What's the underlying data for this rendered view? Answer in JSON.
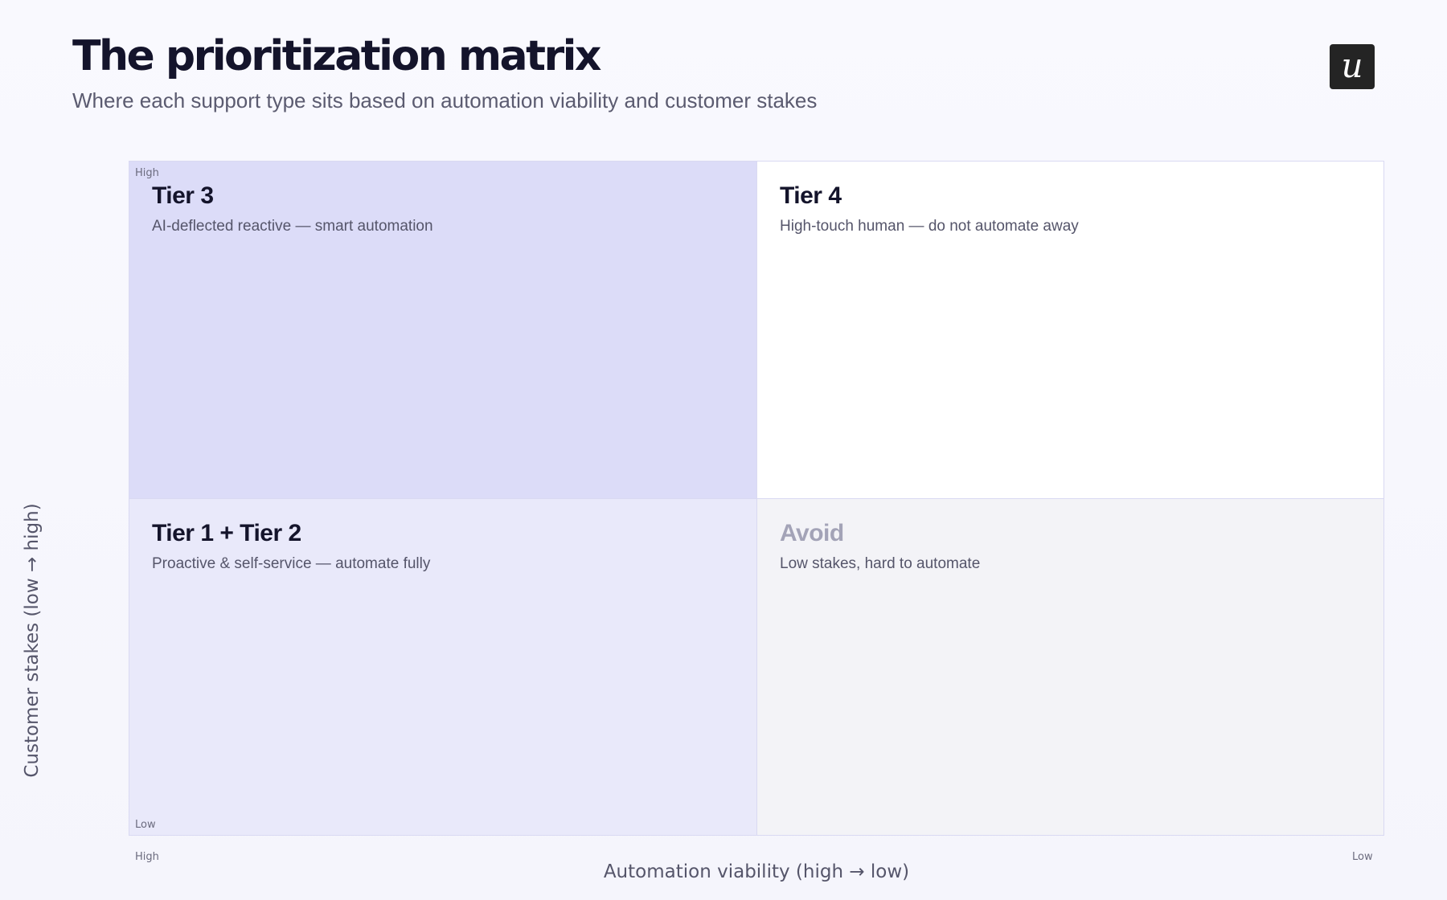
{
  "title": "The prioritization matrix",
  "subtitle": "Where each support type sits based on automation viability and customer stakes",
  "logo": {
    "glyph": "u",
    "icon": "userpilot-logo-icon"
  },
  "quadrants": {
    "top_left": {
      "title": "Tier 3",
      "description": "AI-deflected reactive — smart automation",
      "color": "#dcdcf8"
    },
    "top_right": {
      "title": "Tier 4",
      "description": "High-touch human — do not automate away",
      "color": "#ffffff"
    },
    "bottom_left": {
      "title": "Tier 1 + Tier 2",
      "description": "Proactive & self-service — automate fully",
      "color": "#e9e9fa"
    },
    "bottom_right": {
      "title": "Avoid",
      "description": "Low stakes, hard to automate",
      "color": "#f3f3f7"
    }
  },
  "axes": {
    "x": {
      "label": "Automation viability  (high → low)",
      "start": "High",
      "end": "Low"
    },
    "y": {
      "label": "Customer stakes  (low → high)",
      "start": "Low",
      "end": "High"
    }
  }
}
